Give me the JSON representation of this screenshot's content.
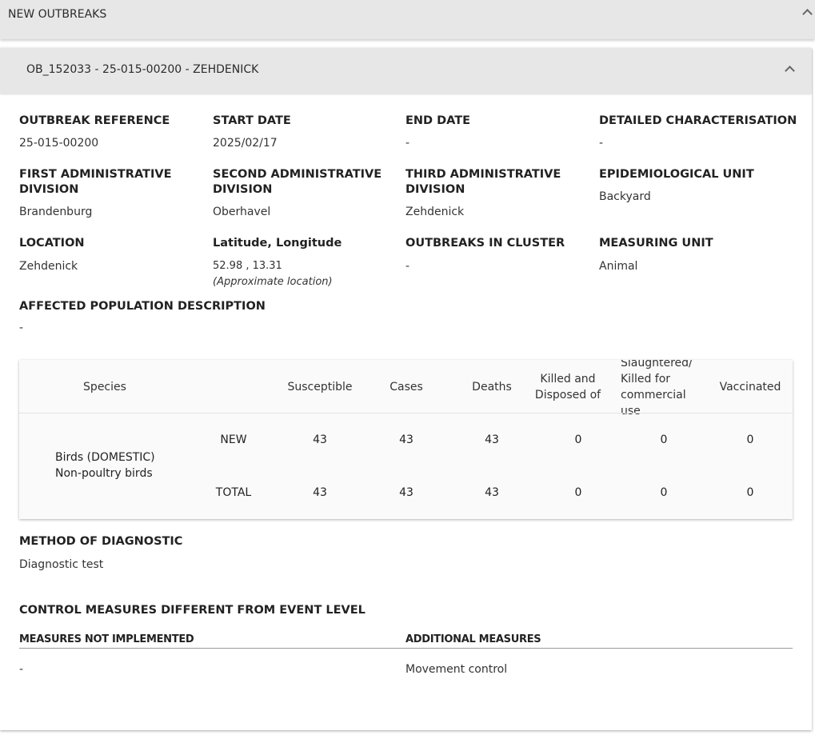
{
  "new_outbreaks": {
    "title": "NEW OUTBREAKS"
  },
  "outbreak": {
    "header": "OB_152033 - 25-015-00200 - ZEHDENICK",
    "fields": [
      {
        "label": "OUTBREAK REFERENCE",
        "value": "25-015-00200"
      },
      {
        "label": "START DATE",
        "value": "2025/02/17"
      },
      {
        "label": "END DATE",
        "value": "-"
      },
      {
        "label": "DETAILED CHARACTERISATION",
        "value": "-"
      },
      {
        "label": "FIRST ADMINISTRATIVE DIVISION",
        "value": "Brandenburg"
      },
      {
        "label": "SECOND ADMINISTRATIVE DIVISION",
        "value": "Oberhavel"
      },
      {
        "label": "THIRD ADMINISTRATIVE DIVISION",
        "value": "Zehdenick"
      },
      {
        "label": "EPIDEMIOLOGICAL UNIT",
        "value": "Backyard"
      },
      {
        "label": "LOCATION",
        "value": "Zehdenick"
      },
      {
        "label": "Latitude, Longitude",
        "value": "52.98 , 13.31",
        "note": "(Approximate location)"
      },
      {
        "label": "OUTBREAKS IN CLUSTER",
        "value": "-"
      },
      {
        "label": "MEASURING UNIT",
        "value": "Animal"
      }
    ],
    "affected_population": {
      "label": "AFFECTED POPULATION DESCRIPTION",
      "value": "-"
    },
    "table": {
      "columns": [
        "Species",
        "Susceptible",
        "Cases",
        "Deaths",
        "Killed and Disposed of",
        "Slaughtered/ Killed for commercial use",
        "Vaccinated"
      ],
      "species": "Birds (DOMESTIC) Non-poultry birds",
      "rows": [
        {
          "type": "NEW",
          "values": [
            "43",
            "43",
            "43",
            "0",
            "0",
            "0"
          ]
        },
        {
          "type": "TOTAL",
          "values": [
            "43",
            "43",
            "43",
            "0",
            "0",
            "0"
          ]
        }
      ]
    },
    "diagnostic": {
      "label": "METHOD OF DIAGNOSTIC",
      "value": "Diagnostic test"
    },
    "control": {
      "label": "CONTROL MEASURES DIFFERENT FROM EVENT LEVEL",
      "not_implemented_label": "MEASURES NOT IMPLEMENTED",
      "not_implemented_value": "-",
      "additional_label": "ADDITIONAL MEASURES",
      "additional_value": "Movement control"
    }
  }
}
